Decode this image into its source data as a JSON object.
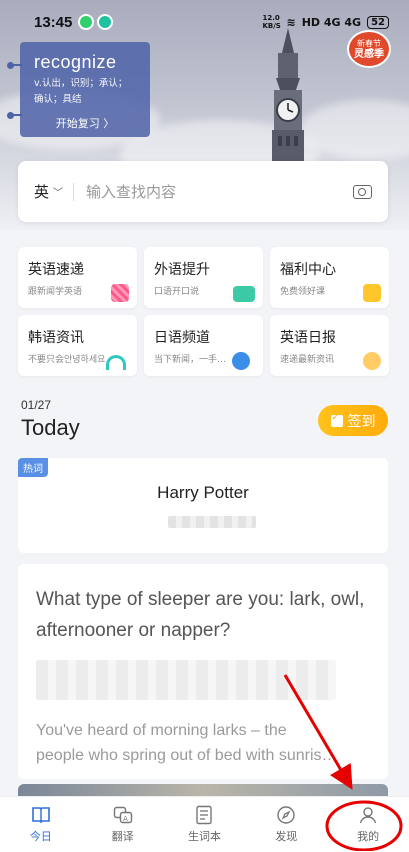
{
  "status": {
    "time": "13:45",
    "network": "12.0 KB/S",
    "signal": "HD 4G 4G",
    "battery": "52"
  },
  "word_card": {
    "word": "recognize",
    "meaning": "v.认出，识别；承认；确认；具结",
    "review": "开始复习 〉"
  },
  "top_avatar": {
    "line1": "新春节",
    "line2": "灵感季"
  },
  "search": {
    "language": "英",
    "placeholder": "输入查找内容"
  },
  "features": [
    {
      "title": "英语速递",
      "subtitle": "跟新闻学英语",
      "icon": "gift-icon",
      "color": "#ff5b8a"
    },
    {
      "title": "外语提升",
      "subtitle": "口语开口说",
      "icon": "book-icon",
      "color": "#3cc9a6"
    },
    {
      "title": "福利中心",
      "subtitle": "免费领好课",
      "icon": "gift-box-icon",
      "color": "#ffc72c"
    },
    {
      "title": "韩语资讯",
      "subtitle": "不要只会안녕하세요",
      "icon": "headphone-icon",
      "color": "#2ec8c2"
    },
    {
      "title": "日语频道",
      "subtitle": "当下新闻，一手…",
      "icon": "doraemon-icon",
      "color": "#3a8ee8"
    },
    {
      "title": "英语日报",
      "subtitle": "速递最新资讯",
      "icon": "girl-avatar-icon",
      "color": "#ffcc66"
    }
  ],
  "today": {
    "date": "01/27",
    "label": "Today",
    "checkin": "签到"
  },
  "hot": {
    "tag": "热词",
    "title": "Harry Potter"
  },
  "article": {
    "title": "What type of sleeper are you: lark, owl, afternooner or napper?",
    "body_line1": "You've heard of morning larks – the",
    "body_line2": "people who spring out of bed with sunris…"
  },
  "nav": [
    {
      "label": "今日",
      "icon": "book-open-icon",
      "active": true
    },
    {
      "label": "翻译",
      "icon": "translate-icon",
      "active": false
    },
    {
      "label": "生词本",
      "icon": "notebook-icon",
      "active": false
    },
    {
      "label": "发现",
      "icon": "compass-icon",
      "active": false
    },
    {
      "label": "我的",
      "icon": "user-icon",
      "active": false
    }
  ],
  "colors": {
    "accent": "#2f6fd6",
    "card": "#4d62a8",
    "checkin": "#ffb211",
    "annotation": "#e60000"
  }
}
